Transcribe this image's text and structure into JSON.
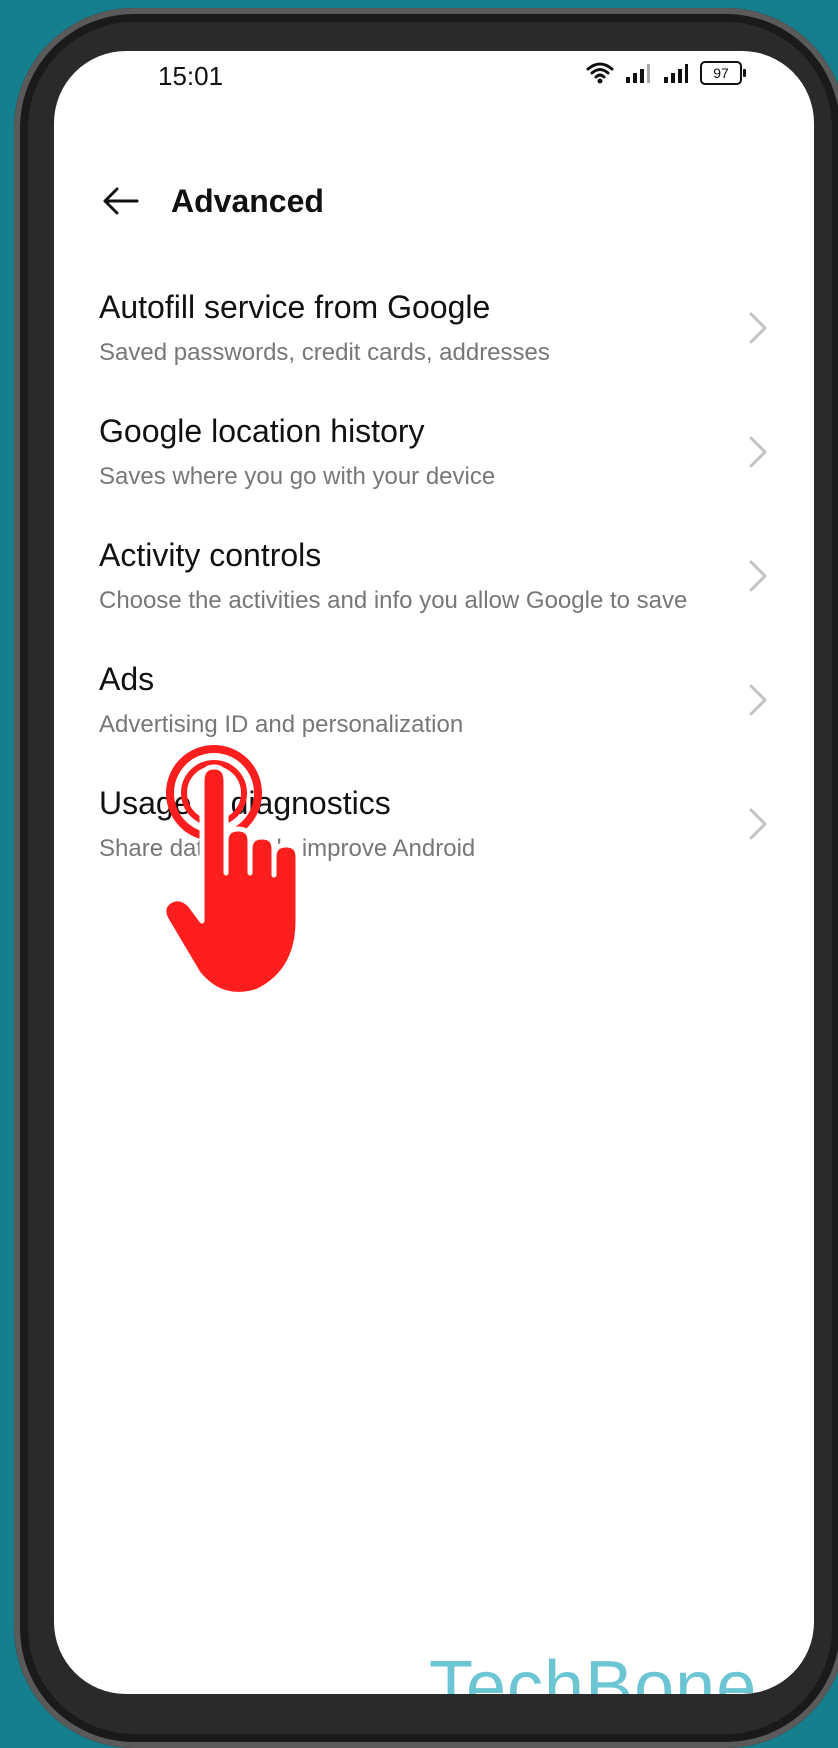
{
  "status_bar": {
    "time": "15:01",
    "battery_level": "97"
  },
  "header": {
    "title": "Advanced"
  },
  "settings_items": [
    {
      "title": "Autofill service from Google",
      "subtitle": "Saved passwords, credit cards, addresses"
    },
    {
      "title": "Google location history",
      "subtitle": "Saves where you go with your device"
    },
    {
      "title": "Activity controls",
      "subtitle": "Choose the activities and info you allow Google to save"
    },
    {
      "title": "Ads",
      "subtitle": "Advertising ID and personalization"
    },
    {
      "title": "Usage & diagnostics",
      "subtitle": "Share data to help improve Android"
    }
  ],
  "icons": {
    "back": "arrow-left-icon",
    "chevron": "chevron-right-icon",
    "wifi": "wifi-icon",
    "signal": "signal-icon",
    "battery": "battery-icon",
    "tap_indicator": "tap-hand-icon"
  },
  "colors": {
    "background": "#167f8e",
    "tap_indicator": "#ff1e1e",
    "watermark": "#6cc5d3"
  },
  "watermark": "TechBone"
}
